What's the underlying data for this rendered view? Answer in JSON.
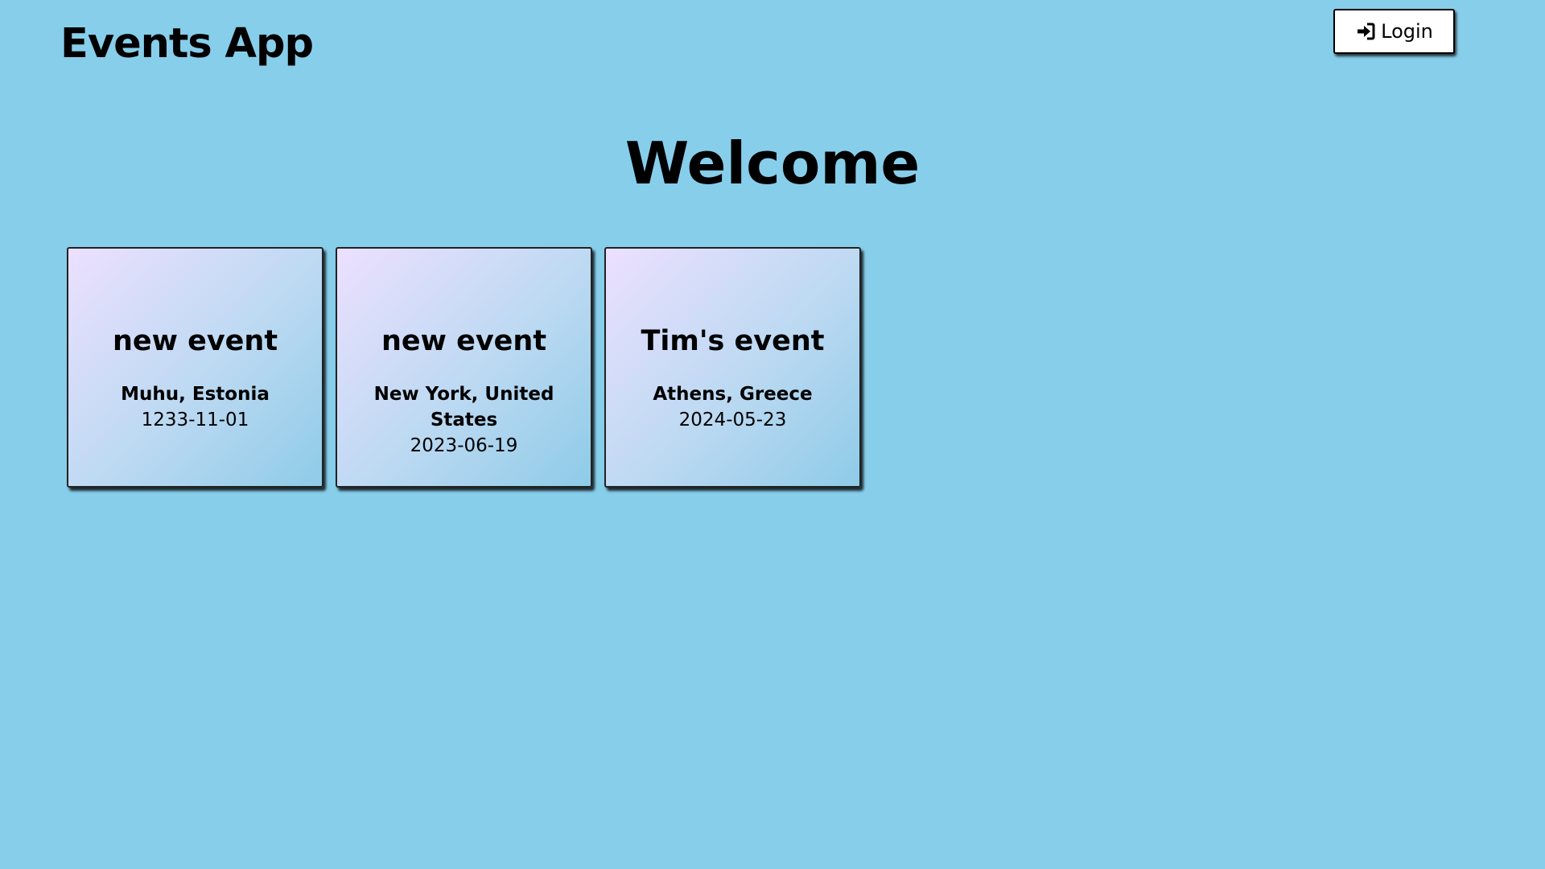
{
  "header": {
    "app_title": "Events App",
    "login_label": "Login",
    "login_icon": "sign-in-icon"
  },
  "main": {
    "heading": "Welcome",
    "events": [
      {
        "title": "new event",
        "location": "Muhu, Estonia",
        "date": "1233-11-01"
      },
      {
        "title": "new event",
        "location": "New York, United States",
        "date": "2023-06-19"
      },
      {
        "title": "Tim's event",
        "location": "Athens, Greece",
        "date": "2024-05-23"
      }
    ]
  },
  "colors": {
    "background": "#87ceeb",
    "card_gradient_start": "#ece0ff",
    "card_gradient_end": "#8ecbe8",
    "button_background": "#ffffff",
    "text": "#000000"
  }
}
